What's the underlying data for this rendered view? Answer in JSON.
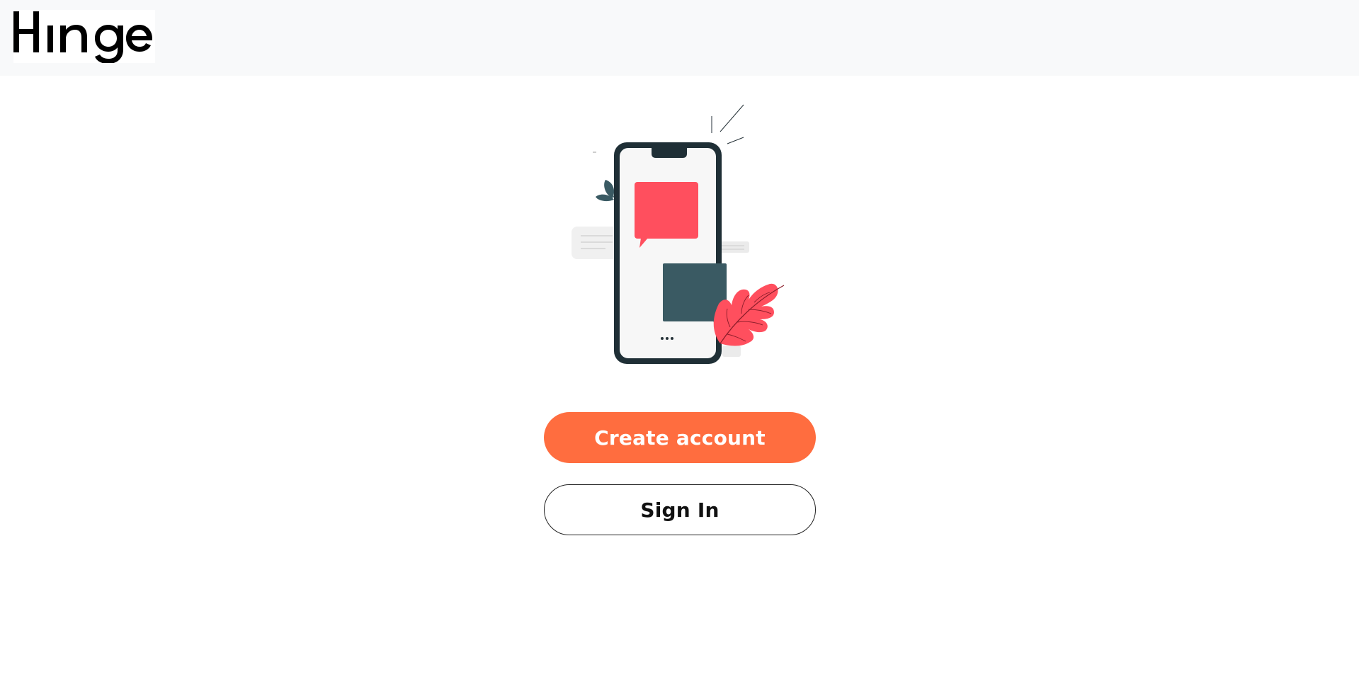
{
  "app": {
    "brand": "Hinge",
    "logo_icon": "hinge-logo"
  },
  "illustration": {
    "icon": "phone-chat-illustration",
    "colors": {
      "phone_frame": "#1f2f36",
      "screen": "#f7f7f7",
      "bubble_primary": "#ff4f5e",
      "bubble_secondary": "#3a5a63",
      "leaf": "#ff4f5e",
      "small_leaves": "#3a5a63"
    }
  },
  "actions": {
    "create_account_label": "Create account",
    "sign_in_label": "Sign In"
  },
  "colors": {
    "header_bg": "#f8f9fa",
    "accent": "#ff6d3f",
    "text_dark": "#111111"
  }
}
